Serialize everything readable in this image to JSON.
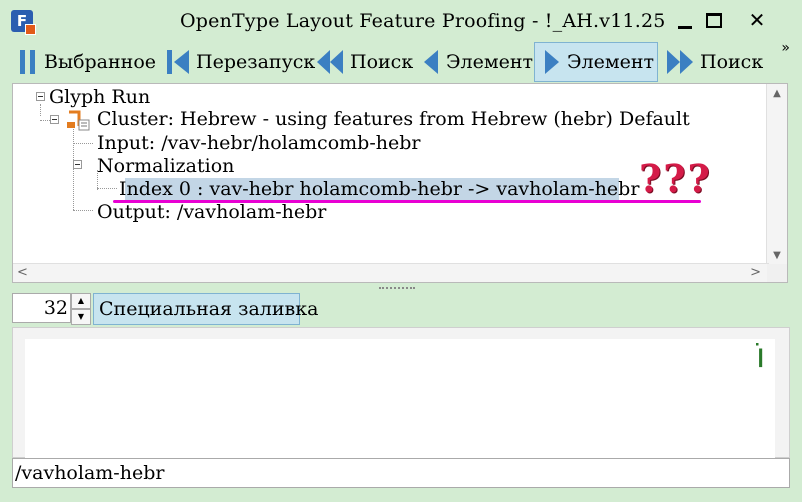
{
  "window": {
    "title": "OpenType Layout Feature Proofing - !_AH.v11.25",
    "close_glyph": "✕"
  },
  "toolbar": {
    "more": "»",
    "buttons": [
      {
        "label": "Выбранное",
        "icon": "pause-icon"
      },
      {
        "label": "Перезапуск",
        "icon": "restart-icon"
      },
      {
        "label": "Поиск",
        "icon": "rewind-icon"
      },
      {
        "label": "Элемент",
        "icon": "step-back-icon"
      },
      {
        "label": "Элемент",
        "icon": "step-forward-icon",
        "active": true
      },
      {
        "label": "Поиск",
        "icon": "fast-forward-icon"
      }
    ]
  },
  "tree": {
    "root": "Glyph Run",
    "cluster": "Cluster: Hebrew - using features from Hebrew (hebr) Default",
    "input": "Input: /vav-hebr/holamcomb-hebr",
    "normalization": "Normalization",
    "index_entry": "Index 0 :  vav-hebr holamcomb-hebr ->  vavholam-hebr",
    "output": "Output: /vavholam-hebr",
    "annotation": "???"
  },
  "controls": {
    "size_value": "32",
    "fill_button": "Специальная заливка"
  },
  "preview": {
    "glyph": "וֹ"
  },
  "status": {
    "text": "/vavholam-hebr"
  },
  "colors": {
    "background": "#d3ecd2",
    "selection": "#c3d6e6",
    "annotation_text": "#d41b48",
    "annotation_line": "#e800d3",
    "active_button": "#c7e4ef"
  }
}
